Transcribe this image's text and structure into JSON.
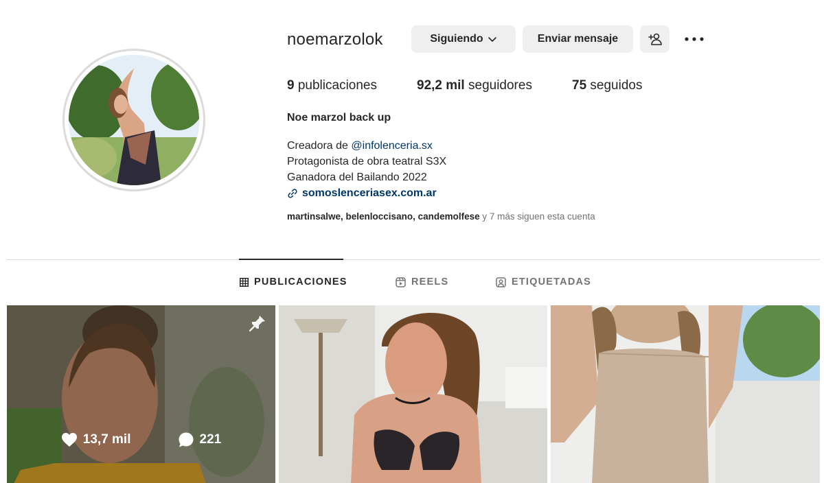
{
  "profile": {
    "username": "noemarzolok",
    "full_name": "Noe marzol back up",
    "stats": {
      "posts_count": "9",
      "posts_label": "publicaciones",
      "followers_count": "92,2 mil",
      "followers_label": "seguidores",
      "following_count": "75",
      "following_label": "seguidos"
    },
    "bio": {
      "line1_prefix": "Creadora de ",
      "line1_mention": "@infolenceria.sx",
      "line2": "Protagonista de obra teatral S3X",
      "line3": "Ganadora del Bailando 2022",
      "link": "somoslenceriasex.com.ar"
    },
    "followed_by": {
      "names": "martinsalwe, belenloccisano, candemolfese",
      "suffix": " y 7 más siguen esta cuenta"
    }
  },
  "actions": {
    "following_label": "Siguiendo",
    "message_label": "Enviar mensaje"
  },
  "tabs": [
    {
      "label": "PUBLICACIONES",
      "icon": "grid-icon",
      "active": true
    },
    {
      "label": "REELS",
      "icon": "reels-icon",
      "active": false
    },
    {
      "label": "ETIQUETADAS",
      "icon": "tagged-icon",
      "active": false
    }
  ],
  "posts": [
    {
      "likes": "13,7 mil",
      "comments": "221",
      "pinned": true,
      "hovered": true
    },
    {
      "pinned": false,
      "hovered": false
    },
    {
      "pinned": false,
      "hovered": false
    }
  ],
  "colors": {
    "text": "#262626",
    "muted": "#737373",
    "link": "#00376b",
    "button_bg": "#efefef",
    "divider": "#dbdbdb"
  }
}
